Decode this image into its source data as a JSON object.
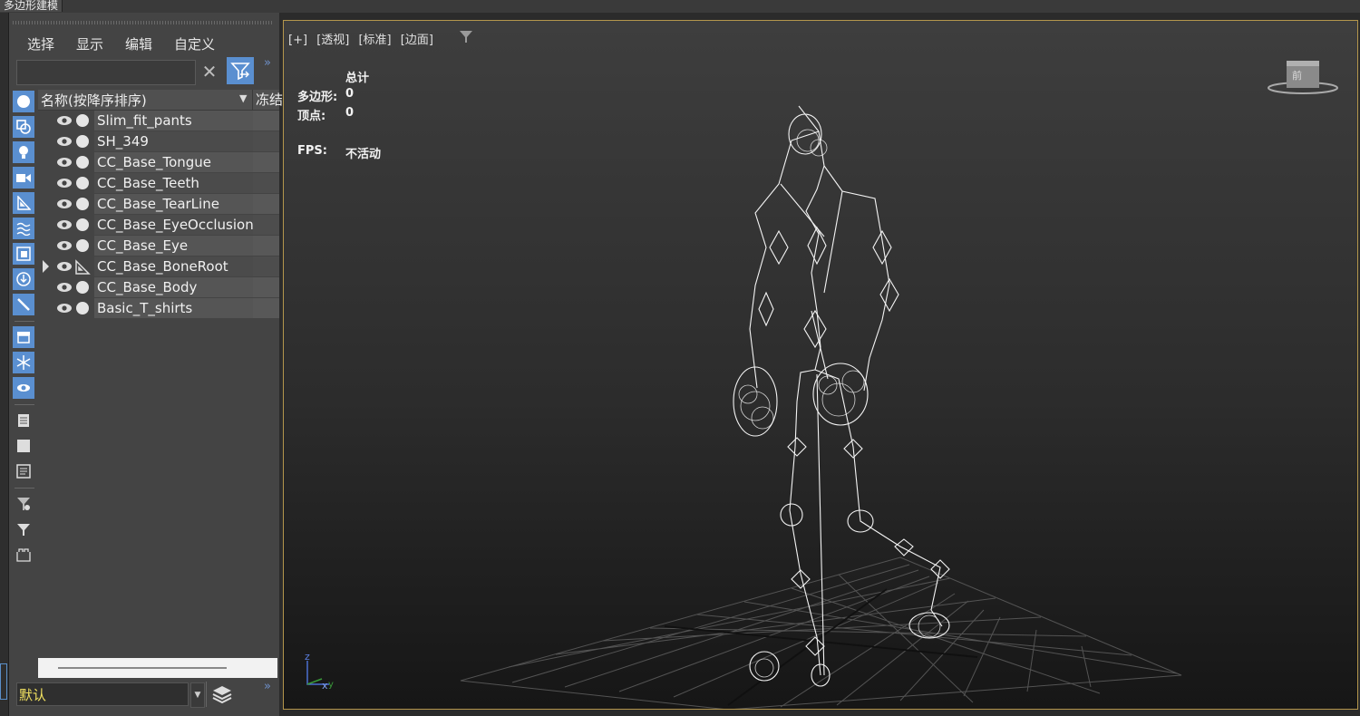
{
  "window": {
    "title_tab": "多边形建模"
  },
  "explorer": {
    "menu": [
      "选择",
      "显示",
      "编辑",
      "自定义"
    ],
    "search": {
      "value": "",
      "placeholder": ""
    },
    "columns": {
      "name": "名称(按降序排序)",
      "frozen": "冻结"
    },
    "filter_icons": [
      "geometry-icon",
      "shapes-icon",
      "lights-icon",
      "cameras-icon",
      "helpers-icon",
      "space-warps-icon",
      "groups-icon",
      "xrefs-icon",
      "bones-icon",
      "containers-icon",
      "frozen-icon",
      "hidden-icon",
      "page-icon",
      "square-icon",
      "page-lines-icon",
      "filter-gear-icon",
      "filter-icon",
      "container-outline-icon"
    ],
    "items": [
      {
        "name": "Slim_fit_pants",
        "type": "geometry",
        "expandable": false
      },
      {
        "name": "SH_349",
        "type": "geometry",
        "expandable": false
      },
      {
        "name": "CC_Base_Tongue",
        "type": "geometry",
        "expandable": false
      },
      {
        "name": "CC_Base_Teeth",
        "type": "geometry",
        "expandable": false
      },
      {
        "name": "CC_Base_TearLine",
        "type": "geometry",
        "expandable": false
      },
      {
        "name": "CC_Base_EyeOcclusion",
        "type": "geometry",
        "expandable": false
      },
      {
        "name": "CC_Base_Eye",
        "type": "geometry",
        "expandable": false
      },
      {
        "name": "CC_Base_BoneRoot",
        "type": "bone",
        "expandable": true
      },
      {
        "name": "CC_Base_Body",
        "type": "geometry",
        "expandable": false
      },
      {
        "name": "Basic_T_shirts",
        "type": "geometry",
        "expandable": false
      }
    ],
    "layer": {
      "value": "默认"
    }
  },
  "viewport": {
    "labels": [
      "[+]",
      "[透视]",
      "[标准]",
      "[边面]"
    ],
    "stats": {
      "header": "总计",
      "polygons_label": "多边形:",
      "polygons_value": "0",
      "vertices_label": "顶点:",
      "vertices_value": "0",
      "fps_label": "FPS:",
      "fps_value": "不活动"
    },
    "viewcube_text": "前",
    "axis": {
      "z": "z",
      "x": "x",
      "y": "y"
    },
    "border_color": "#b4964c"
  }
}
